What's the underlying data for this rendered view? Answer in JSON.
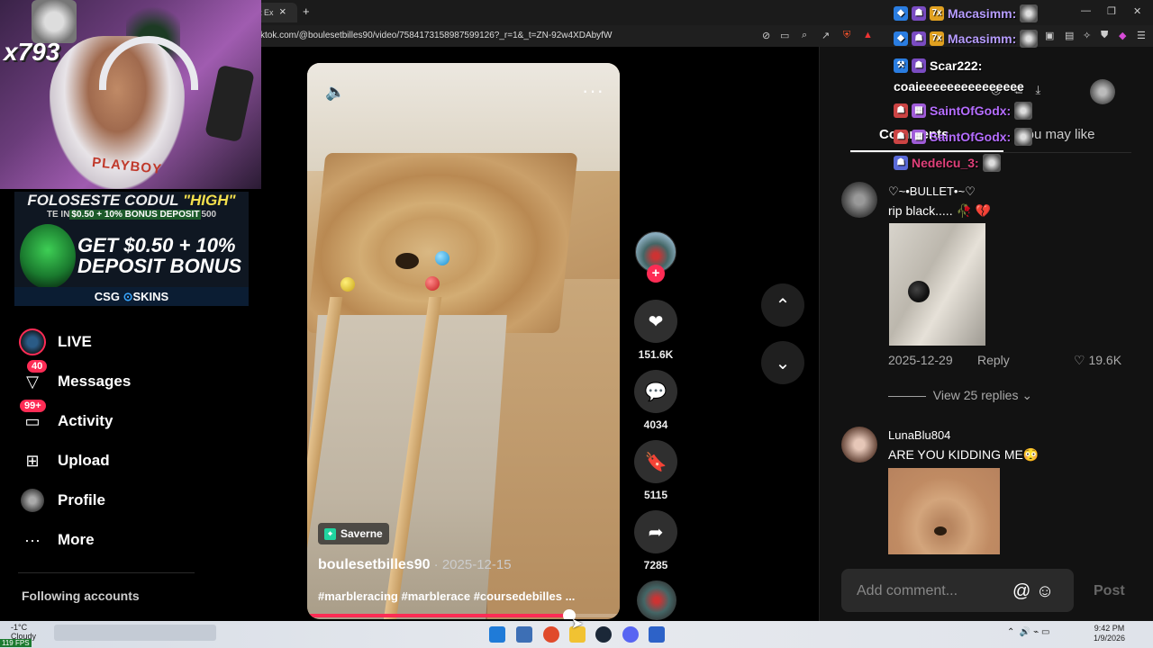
{
  "browser": {
    "tab_title": "t Ex",
    "tab_close": "×",
    "new_tab": "+",
    "url": "ktok.com/@boulesetbilles90/video/7584173158987599126?_r=1&_t=ZN-92w4XDAbyfW"
  },
  "stream": {
    "counter": "x793",
    "shirt_text": "PLAYBOY"
  },
  "ad": {
    "line1_prefix": "FOLOSESTE CODUL ",
    "line1_code": "\"HIGH\"",
    "line2_prefix": "TE IN",
    "line2_highlight": "$0.50 + 10% BONUS DEPOSIT",
    "line2_suffix": "500",
    "headline1": "GET $0.50 + 10%",
    "headline2": "DEPOSIT BONUS",
    "brand_left": "CSG",
    "brand_right": "SKINS"
  },
  "sidebar": {
    "items": [
      {
        "label": "LIVE"
      },
      {
        "label": "Messages",
        "badge": "40"
      },
      {
        "label": "Activity",
        "badge": "99+"
      },
      {
        "label": "Upload"
      },
      {
        "label": "Profile"
      },
      {
        "label": "More"
      }
    ],
    "following_title": "Following accounts"
  },
  "video": {
    "location": "Saverne",
    "author": "boulesetbilles90",
    "date": "2025-12-15",
    "separator": " · ",
    "hashtags": "#marbleracing #marblerace #coursedebilles ...",
    "progress": 0.84
  },
  "actions": {
    "likes": "151.6K",
    "comments": "4034",
    "saves": "5115",
    "shares": "7285"
  },
  "panel": {
    "tab_comments": "Comments",
    "tab_you_may_like": "You may like",
    "comments": [
      {
        "name": "♡~•BULLET•~♡",
        "text": "rip black..... 🥀 💔",
        "date": "2025-12-29",
        "reply": "Reply",
        "likes": "19.6K",
        "view_replies": "View 25 replies"
      },
      {
        "name": "LunaBlu804",
        "text": "ARE YOU KIDDING ME😳"
      }
    ],
    "add_comment_placeholder": "Add comment...",
    "post_label": "Post"
  },
  "chat": [
    {
      "user": "Macasimm:",
      "color": "#b69cff",
      "badge": "7x"
    },
    {
      "user": "Macasimm:",
      "color": "#b69cff",
      "badge": "7x"
    },
    {
      "user": "Scar222:",
      "color": "#ffffff"
    },
    {
      "message": "coaieeeeeeeeeeeeeee",
      "color": "#ffffff"
    },
    {
      "user": "SaintOfGodx:",
      "color": "#b56dff"
    },
    {
      "user": "SaintOfGodx:",
      "color": "#b56dff"
    },
    {
      "user": "Nedelcu_3:",
      "color": "#e0407a"
    }
  ],
  "taskbar": {
    "temp": "-1°C",
    "weather": "Cloudy",
    "time": "9:42 PM",
    "date": "1/9/2026",
    "fps": "119 FPS"
  },
  "colors": {
    "accent": "#fe2c55",
    "location_icon": "#20d5a0",
    "chat_purple": "#b69cff",
    "chat_pink": "#e0407a"
  }
}
